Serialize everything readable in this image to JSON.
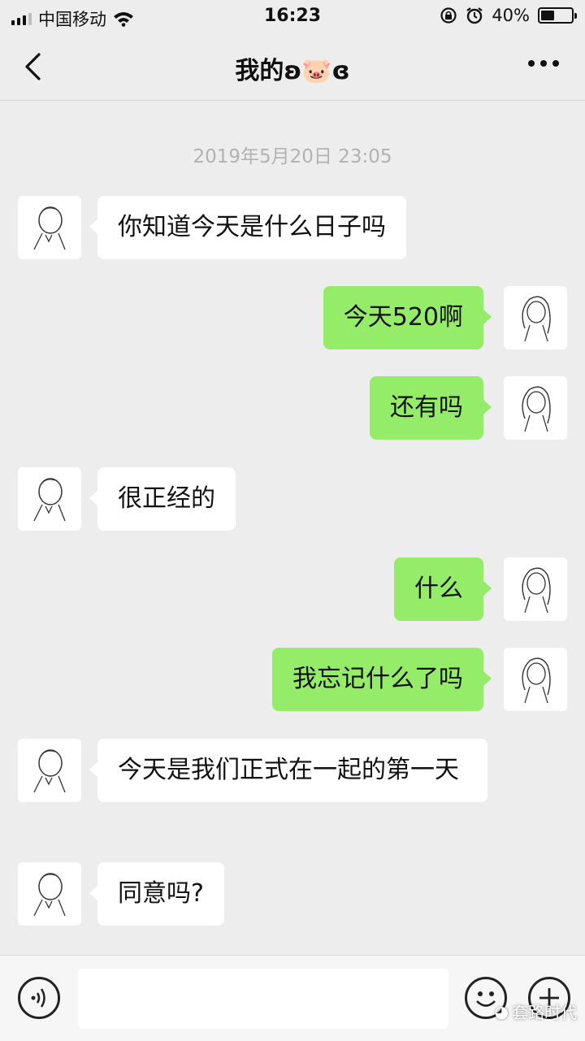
{
  "status_bar": {
    "carrier": "中国移动",
    "time": "16:23",
    "battery": "40%",
    "battery_level": 0.4
  },
  "nav": {
    "title": "我的ʚ🐷ɞ",
    "back_icon": "chevron-left-icon",
    "more_icon": "more-dots-icon"
  },
  "chat": {
    "timestamp": "2019年5月20日 23:05",
    "messages": [
      {
        "from": "other",
        "text": "你知道今天是什么日子吗"
      },
      {
        "from": "me",
        "text": "今天520啊"
      },
      {
        "from": "me",
        "text": "还有吗"
      },
      {
        "from": "other",
        "text": "很正经的"
      },
      {
        "from": "me",
        "text": "什么"
      },
      {
        "from": "me",
        "text": "我忘记什么了吗"
      },
      {
        "from": "other",
        "text": "今天是我们正式在一起的第一天"
      },
      {
        "from": "other",
        "text": "同意吗?"
      }
    ]
  },
  "input_bar": {
    "text_value": "",
    "voice_icon": "voice-icon",
    "emoji_icon": "emoji-icon",
    "plus_icon": "plus-icon"
  },
  "watermark": "套路时代",
  "colors": {
    "background": "#ededed",
    "outgoing_bubble": "#95ec69",
    "incoming_bubble": "#ffffff",
    "timestamp": "#b2b2b2"
  }
}
